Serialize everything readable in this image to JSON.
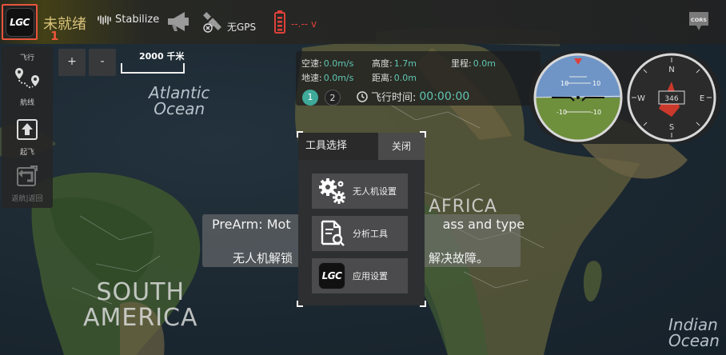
{
  "app": {
    "logo_text": "LGC",
    "logo_index": "1"
  },
  "topbar": {
    "status": "未就绪",
    "mode": "Stabilize",
    "gps_label": "无GPS",
    "battery_text": "--.-- v",
    "cors_label": "CORS"
  },
  "left_panel": {
    "title": "飞行",
    "items": [
      {
        "label": "航线",
        "icon": "route-icon"
      },
      {
        "label": "起飞",
        "icon": "takeoff-icon"
      },
      {
        "label": "返航|返回",
        "icon": "return-icon"
      }
    ]
  },
  "map": {
    "zoom_in": "+",
    "zoom_out": "-",
    "scale_text": "2000 千米",
    "labels": {
      "atlantic": "Atlantic\nOcean",
      "africa": "AFRICA",
      "south_america": "SOUTH\nAMERICA",
      "indian": "Indian\nOcean"
    }
  },
  "telemetry": {
    "airspeed_label": "空速:",
    "airspeed": "0.0m/s",
    "altitude_label": "高度:",
    "altitude": "1.7m",
    "mileage_label": "里程:",
    "mileage": "0.0m",
    "groundspeed_label": "地速:",
    "groundspeed": "0.0m/s",
    "distance_label": "距离:",
    "distance": "0.0m",
    "flight_time_label": "飞行时间:",
    "flight_time": "00:00:00",
    "badges": [
      "1",
      "2"
    ]
  },
  "instruments": {
    "heading": "346",
    "compass": {
      "n": "N",
      "e": "E",
      "s": "S",
      "w": "W"
    },
    "pitch_labels": [
      "10",
      "10",
      "-10",
      "-10"
    ]
  },
  "prearm": {
    "line1_visible": "PreArm: Mot",
    "line1_end": "ass and type",
    "line2_visible": "无人机解锁",
    "line2_end": "解决故障。"
  },
  "tool_dialog": {
    "title": "工具选择",
    "close": "关闭",
    "buttons": [
      {
        "label": "无人机设置",
        "icon": "gears-icon"
      },
      {
        "label": "分析工具",
        "icon": "analysis-icon"
      },
      {
        "label": "应用设置",
        "icon": "app-logo-icon"
      }
    ]
  },
  "colors": {
    "accent": "#5fc6b5",
    "warning": "#e0403a",
    "highlight": "#e8553b"
  }
}
